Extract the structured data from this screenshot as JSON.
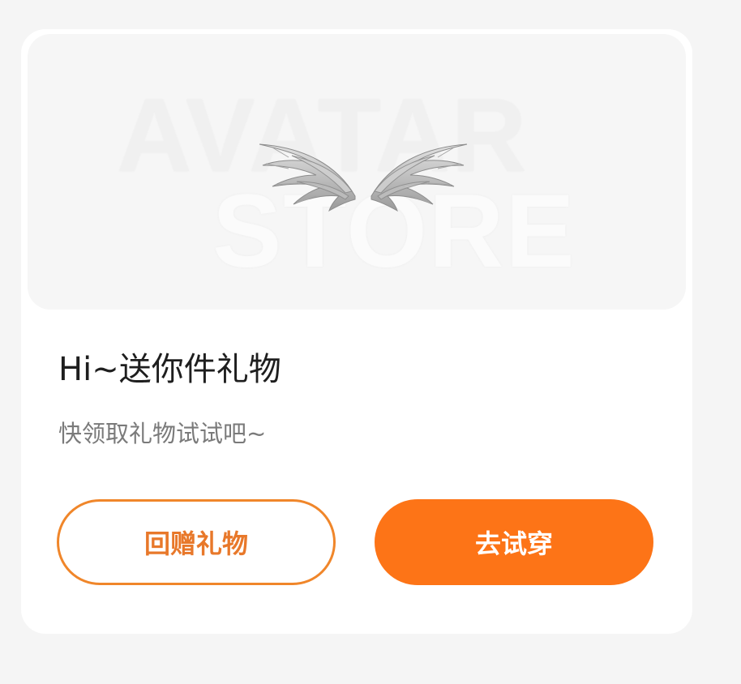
{
  "banner": {
    "watermark_line1": "AVATAR",
    "watermark_line2": "STORE",
    "image_icon": "angel-wings-icon"
  },
  "gift": {
    "title": "Hi~送你件礼物",
    "subtitle": "快领取礼物试试吧~"
  },
  "actions": {
    "return_gift_label": "回赠礼物",
    "try_on_label": "去试穿"
  },
  "colors": {
    "accent": "#fd7417",
    "outline": "#f0862a",
    "title": "#1e1e1e",
    "subtitle": "#7a7a7a"
  }
}
